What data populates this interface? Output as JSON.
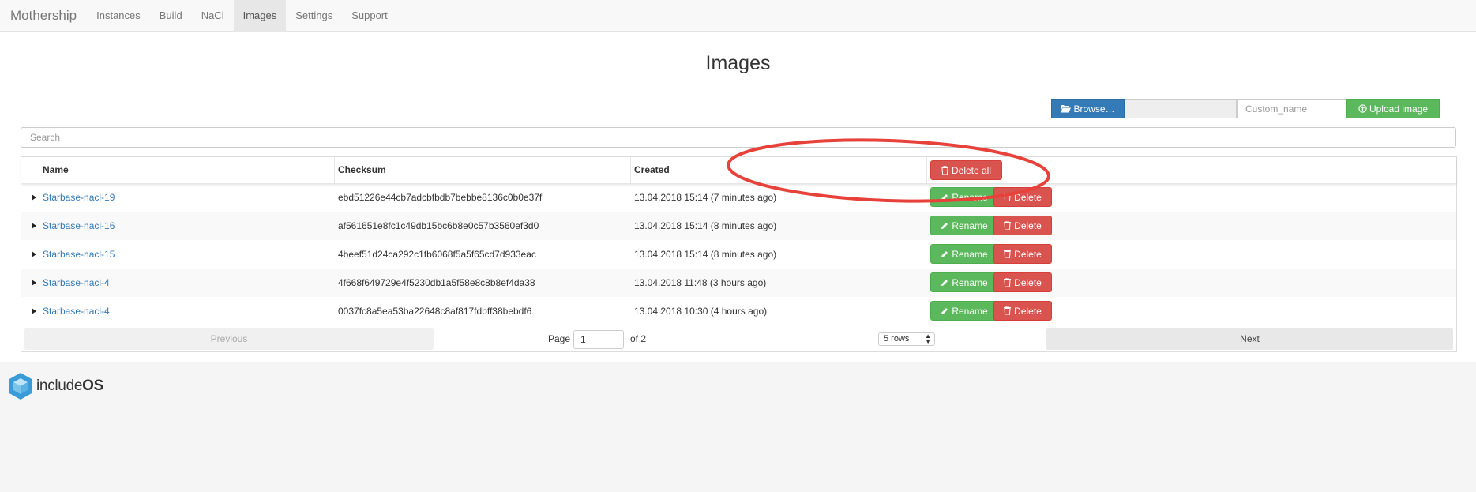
{
  "navbar": {
    "brand": "Mothership",
    "items": [
      {
        "label": "Instances",
        "active": false
      },
      {
        "label": "Build",
        "active": false
      },
      {
        "label": "NaCl",
        "active": false
      },
      {
        "label": "Images",
        "active": true
      },
      {
        "label": "Settings",
        "active": false
      },
      {
        "label": "Support",
        "active": false
      }
    ]
  },
  "page": {
    "title": "Images"
  },
  "upload": {
    "browse_label": "Browse…",
    "custom_name_placeholder": "Custom_name",
    "upload_label": "Upload image"
  },
  "search": {
    "placeholder": "Search"
  },
  "table": {
    "headers": {
      "name": "Name",
      "checksum": "Checksum",
      "created": "Created",
      "delete_all": "Delete all"
    },
    "rename_label": "Rename",
    "delete_label": "Delete",
    "rows": [
      {
        "name": "Starbase-nacl-19",
        "checksum": "ebd51226e44cb7adcbfbdb7bebbe8136c0b0e37f",
        "created": "13.04.2018 15:14 (7 minutes ago)"
      },
      {
        "name": "Starbase-nacl-16",
        "checksum": "af561651e8fc1c49db15bc6b8e0c57b3560ef3d0",
        "created": "13.04.2018 15:14 (8 minutes ago)"
      },
      {
        "name": "Starbase-nacl-15",
        "checksum": "4beef51d24ca292c1fb6068f5a5f65cd7d933eac",
        "created": "13.04.2018 15:14 (8 minutes ago)"
      },
      {
        "name": "Starbase-nacl-4",
        "checksum": "4f668f649729e4f5230db1a5f58e8c8b8ef4da38",
        "created": "13.04.2018 11:48 (3 hours ago)"
      },
      {
        "name": "Starbase-nacl-4",
        "checksum": "0037fc8a5ea53ba22648c8af817fdbff38bebdf6",
        "created": "13.04.2018 10:30 (4 hours ago)"
      }
    ]
  },
  "pagination": {
    "previous": "Previous",
    "page_label": "Page",
    "current_page": "1",
    "of_label": "of 2",
    "rows_option": "5 rows",
    "next": "Next"
  },
  "footer": {
    "logo_light": "include",
    "logo_bold": "OS"
  },
  "colors": {
    "primary": "#337ab7",
    "success": "#5cb85c",
    "danger": "#d9534f",
    "annotation": "#e8413a"
  }
}
